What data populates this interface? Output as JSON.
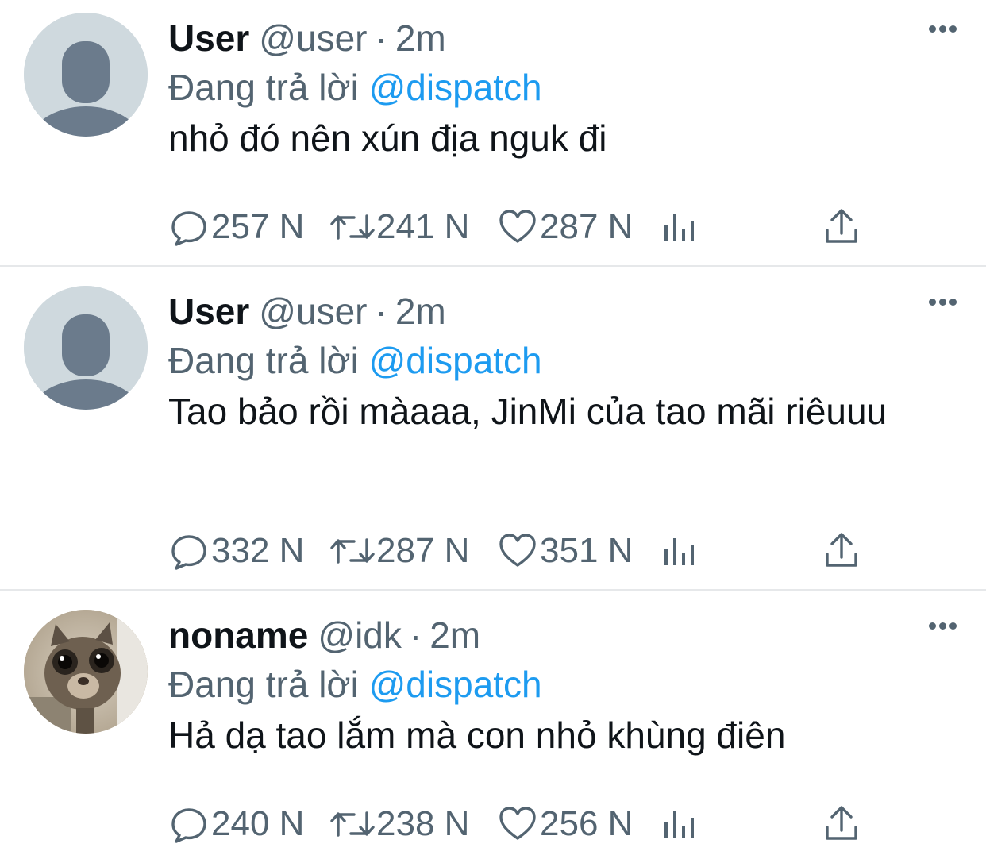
{
  "tweets": [
    {
      "name": "User",
      "handle": "@user",
      "separator": "·",
      "time": "2m",
      "reply_prefix": "Đang trả lời",
      "reply_to": "@dispatch",
      "text": "nhỏ đó nên xún địa nguk đi",
      "avatar": "default-avatar",
      "replies": "257 N",
      "retweets": "241 N",
      "likes": "287 N"
    },
    {
      "name": "User",
      "handle": "@user",
      "separator": "·",
      "time": "2m",
      "reply_prefix": "Đang trả lời",
      "reply_to": "@dispatch",
      "text": "Tao bảo rồi màaaa, JinMi của tao mãi riêuuu",
      "avatar": "default-avatar",
      "replies": "332 N",
      "retweets": "287 N",
      "likes": "351 N"
    },
    {
      "name": "noname",
      "handle": "@idk",
      "separator": "·",
      "time": "2m",
      "reply_prefix": "Đang trả lời",
      "reply_to": "@dispatch",
      "text": "Hả dạ tao lắm mà con nhỏ khùng điên",
      "avatar": "cat-photo-avatar",
      "replies": "240 N",
      "retweets": "238 N",
      "likes": "256 N"
    }
  ],
  "icons": {
    "reply": "reply-bubble-icon",
    "retweet": "retweet-arrows-icon",
    "like": "heart-icon",
    "analytics": "bar-chart-icon",
    "share": "share-upload-icon",
    "more": "more-dots-icon"
  },
  "colors": {
    "text": "#0f1419",
    "secondary": "#536471",
    "link": "#1d9bf0",
    "divider": "#e6e8ea",
    "avatar_bg": "#cfd9de",
    "avatar_fg": "#6b7b8c"
  }
}
